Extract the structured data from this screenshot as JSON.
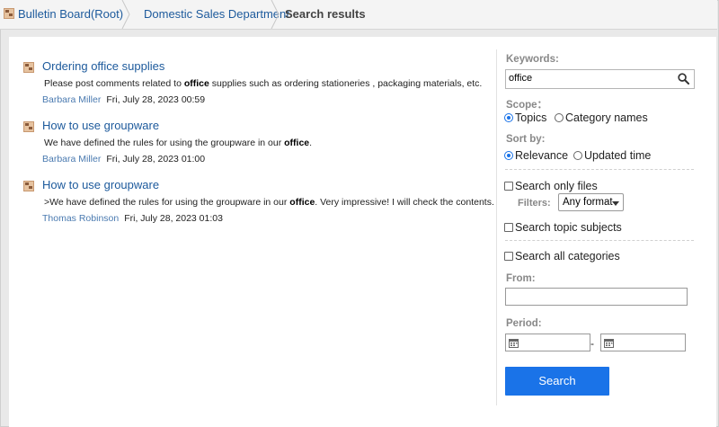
{
  "breadcrumb": {
    "root": "Bulletin Board(Root)",
    "department": "Domestic Sales Department",
    "current": "Search results"
  },
  "results": [
    {
      "title": "Ordering office supplies",
      "snippet_pre": "Please post comments related to ",
      "snippet_hl": "office",
      "snippet_post": " supplies such as ordering stationeries , packaging materials, etc.",
      "author": "Barbara Miller",
      "date": "Fri, July 28, 2023 00:59"
    },
    {
      "title": "How to use groupware",
      "snippet_pre": "We have defined the rules for using the groupware in our ",
      "snippet_hl": "office",
      "snippet_post": ".",
      "author": "Barbara Miller",
      "date": "Fri, July 28, 2023 01:00"
    },
    {
      "title": "How to use groupware",
      "snippet_pre": ">We have defined the rules for using the groupware in our ",
      "snippet_hl": "office",
      "snippet_post": ". Very impressive! I will check the contents.",
      "author": "Thomas Robinson",
      "date": "Fri, July 28, 2023 01:03"
    }
  ],
  "panel": {
    "keywords_label": "Keywords:",
    "keywords_value": "office",
    "scope_label": "Scope：",
    "scope_topics": "Topics",
    "scope_categories": "Category names",
    "sort_label": "Sort by:",
    "sort_relevance": "Relevance",
    "sort_updated": "Updated time",
    "search_files": "Search only files",
    "filters_label": "Filters:",
    "filters_value": "Any format",
    "search_subjects": "Search topic subjects",
    "search_all_categories": "Search all categories",
    "from_label": "From:",
    "period_label": "Period:",
    "period_dash": "-",
    "search_button": "Search"
  },
  "colors": {
    "link": "#1d5a9c",
    "accent": "#1a73e8",
    "author": "#4a7ab0"
  }
}
